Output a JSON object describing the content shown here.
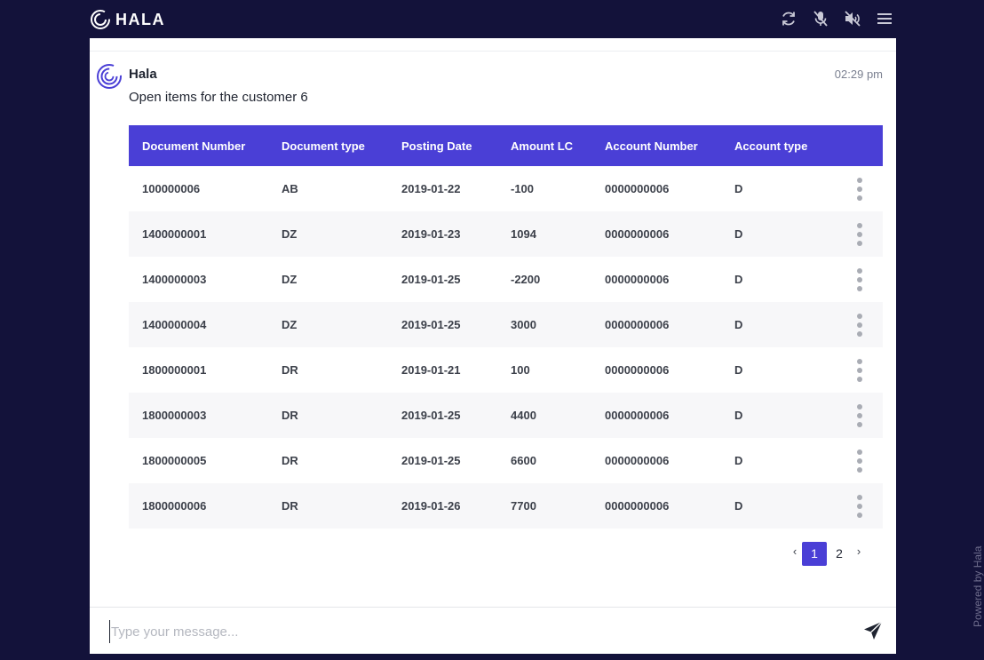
{
  "brand": {
    "name": "HALA"
  },
  "toolbar": {
    "icons": [
      "refresh-icon",
      "mic-off-icon",
      "speaker-off-icon",
      "menu-icon"
    ]
  },
  "chat": {
    "sender": "Hala",
    "time": "02:29 pm",
    "message": "Open items for the customer 6"
  },
  "table": {
    "columns": [
      "Document Number",
      "Document type",
      "Posting Date",
      "Amount LC",
      "Account Number",
      "Account type"
    ],
    "rows": [
      [
        "100000006",
        "AB",
        "2019-01-22",
        "-100",
        "0000000006",
        "D"
      ],
      [
        "1400000001",
        "DZ",
        "2019-01-23",
        "1094",
        "0000000006",
        "D"
      ],
      [
        "1400000003",
        "DZ",
        "2019-01-25",
        "-2200",
        "0000000006",
        "D"
      ],
      [
        "1400000004",
        "DZ",
        "2019-01-25",
        "3000",
        "0000000006",
        "D"
      ],
      [
        "1800000001",
        "DR",
        "2019-01-21",
        "100",
        "0000000006",
        "D"
      ],
      [
        "1800000003",
        "DR",
        "2019-01-25",
        "4400",
        "0000000006",
        "D"
      ],
      [
        "1800000005",
        "DR",
        "2019-01-25",
        "6600",
        "0000000006",
        "D"
      ],
      [
        "1800000006",
        "DR",
        "2019-01-26",
        "7700",
        "0000000006",
        "D"
      ]
    ]
  },
  "pagination": {
    "prev": "‹",
    "pages": [
      "1",
      "2"
    ],
    "current": "1",
    "next": "›"
  },
  "input": {
    "placeholder": "Type your message..."
  },
  "footer": {
    "powered": "Powered by Hala"
  },
  "colors": {
    "background": "#13123a",
    "accent": "#4a3fd6"
  }
}
